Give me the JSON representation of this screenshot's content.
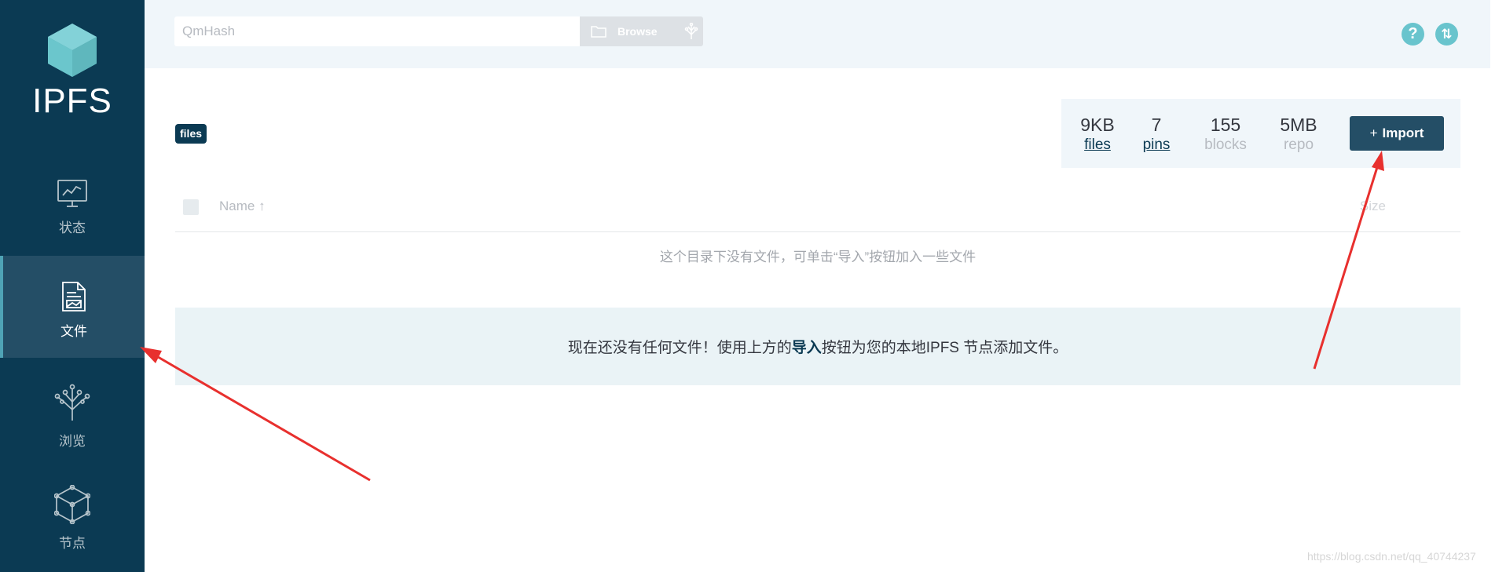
{
  "sidebar": {
    "logo_text": "IPFS",
    "items": [
      {
        "label": "状态",
        "icon": "status-monitor-icon"
      },
      {
        "label": "文件",
        "icon": "files-icon",
        "active": true
      },
      {
        "label": "浏览",
        "icon": "explore-tree-icon"
      },
      {
        "label": "节点",
        "icon": "peers-cube-icon"
      }
    ]
  },
  "topbar": {
    "search_placeholder": "QmHash",
    "browse_label": "Browse"
  },
  "breadcrumb": "files",
  "stats": {
    "files": {
      "value": "9KB",
      "label": "files"
    },
    "pins": {
      "value": "7",
      "label": "pins"
    },
    "blocks": {
      "value": "155",
      "label": "blocks"
    },
    "repo": {
      "value": "5MB",
      "label": "repo"
    }
  },
  "import_label": "Import",
  "import_plus": "+",
  "table": {
    "col_name": "Name ↑",
    "col_size": "Size"
  },
  "empty_note": "这个目录下没有文件，可单击“导入”按钮加入一些文件",
  "banner": {
    "before": "现在还没有任何文件！使用上方的",
    "bold": "导入",
    "after": "按钮为您的本地IPFS 节点添加文件。"
  },
  "watermark": "https://blog.csdn.net/qq_40744237",
  "colors": {
    "sidebar": "#0b3a53",
    "active_item": "#244e66",
    "accent_teal": "#69c4cd",
    "annotation_red": "#e8302e"
  }
}
